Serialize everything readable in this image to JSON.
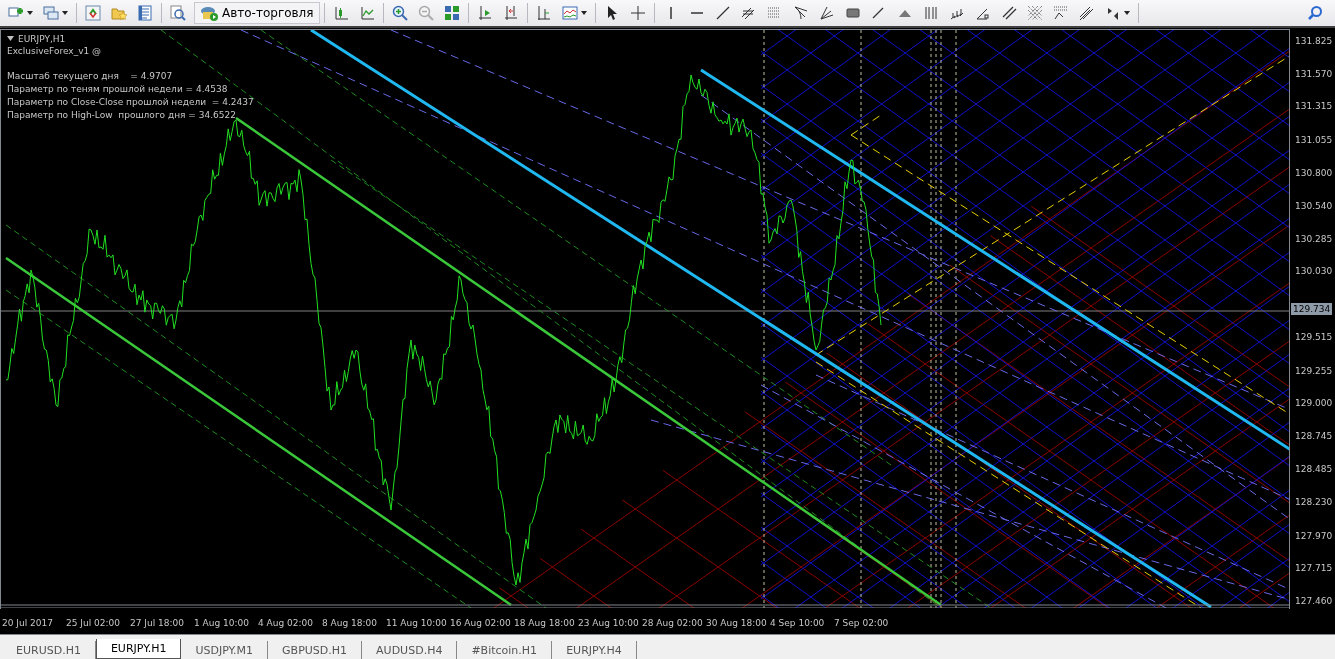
{
  "toolbar": {
    "auto_trading_label": "Авто-торговля"
  },
  "chart": {
    "symbol_label": "EURJPY,H1",
    "indicator_label": "ExclusiveForex_v1 @",
    "info_lines": [
      "Масштаб текущего дня    = 4.9707",
      "Параметр по теням прошлой недели = 4.4538",
      "Параметр по Close-Close прошлой недели  = 4.2437",
      "Параметр по High-Low  прошлого дня = 34.6522"
    ],
    "current_price": "129.734",
    "price_axis": [
      "131.825",
      "131.570",
      "131.315",
      "131.055",
      "130.800",
      "130.540",
      "130.285",
      "130.030",
      "129.515",
      "129.255",
      "129.000",
      "128.745",
      "128.485",
      "128.230",
      "127.970",
      "127.715",
      "127.460"
    ],
    "time_axis": [
      "20 Jul 2017",
      "25 Jul 02:00",
      "27 Jul 18:00",
      "1 Aug 10:00",
      "4 Aug 02:00",
      "8 Aug 18:00",
      "11 Aug 10:00",
      "16 Aug 02:00",
      "18 Aug 18:00",
      "23 Aug 10:00",
      "28 Aug 02:00",
      "30 Aug 18:00",
      "4 Sep 10:00",
      "7 Sep 02:00"
    ]
  },
  "tabs": [
    {
      "label": "EURUSD.H1",
      "selected": false
    },
    {
      "label": "EURJPY.H1",
      "selected": true
    },
    {
      "label": "USDJPY.M1",
      "selected": false
    },
    {
      "label": "GBPUSD.H1",
      "selected": false
    },
    {
      "label": "AUDUSD.H4",
      "selected": false
    },
    {
      "label": "#Bitcoin.H1",
      "selected": false
    },
    {
      "label": "EURJPY.H4",
      "selected": false
    }
  ]
}
